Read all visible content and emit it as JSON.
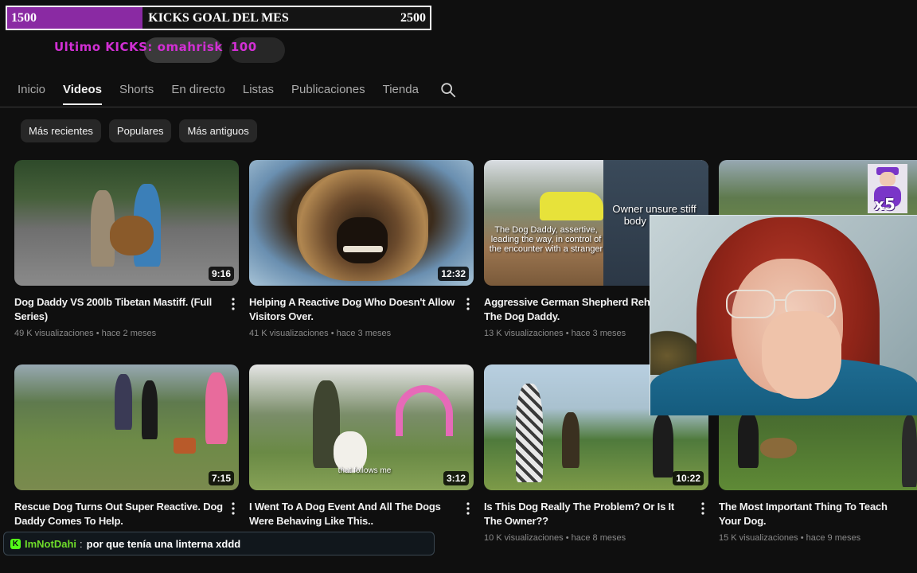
{
  "goal": {
    "min": "1500",
    "max": "2500",
    "title": "KICKS GOAL DEL MES",
    "progress_fraction": 0.32,
    "fill_color": "#8a2aa3"
  },
  "last_kick": {
    "label": "Ultimo KICKS: omahrisk",
    "amount": "100"
  },
  "tabs": [
    {
      "label": "Inicio"
    },
    {
      "label": "Videos"
    },
    {
      "label": "Shorts"
    },
    {
      "label": "En directo"
    },
    {
      "label": "Listas"
    },
    {
      "label": "Publicaciones"
    },
    {
      "label": "Tienda"
    }
  ],
  "active_tab": "Videos",
  "chips": [
    {
      "label": "Más recientes"
    },
    {
      "label": "Populares"
    },
    {
      "label": "Más antiguos"
    }
  ],
  "videos": [
    {
      "title": "Dog Daddy VS 200lb Tibetan Mastiff. (Full Series)",
      "meta": "49 K visualizaciones • hace 2 meses",
      "duration": "9:16"
    },
    {
      "title": "Helping A Reactive Dog Who Doesn't Allow Visitors Over.",
      "meta": "41 K visualizaciones • hace 3 meses",
      "duration": "12:32"
    },
    {
      "title": "Aggressive German Shepherd Rehab With The Dog Daddy.",
      "meta": "13 K visualizaciones • hace 3 meses",
      "duration": "",
      "caption_left": "The Dog Daddy, assertive, leading the way, in control of the encounter with a stranger",
      "caption_right": "Owner unsure stiff body Lacking"
    },
    {
      "title": "",
      "meta": "",
      "duration": ""
    },
    {
      "title": "Rescue Dog Turns Out Super Reactive. Dog Daddy Comes To Help.",
      "meta": "",
      "duration": "7:15"
    },
    {
      "title": "I Went To A Dog Event And All The Dogs Were Behaving Like This..",
      "meta": "",
      "duration": "3:12",
      "caption": "that follows me"
    },
    {
      "title": "Is This Dog Really The Problem? Or Is It The Owner??",
      "meta": "10 K visualizaciones • hace 8 meses",
      "duration": "10:22"
    },
    {
      "title": "The Most Important Thing To Teach Your Dog.",
      "meta": "15 K visualizaciones • hace 9 meses",
      "duration": ""
    }
  ],
  "badge": {
    "count": "x5"
  },
  "chat": {
    "username": "ImNotDahi",
    "separator": ":",
    "message": "por que tenía una linterna xddd",
    "icon_letter": "K"
  }
}
